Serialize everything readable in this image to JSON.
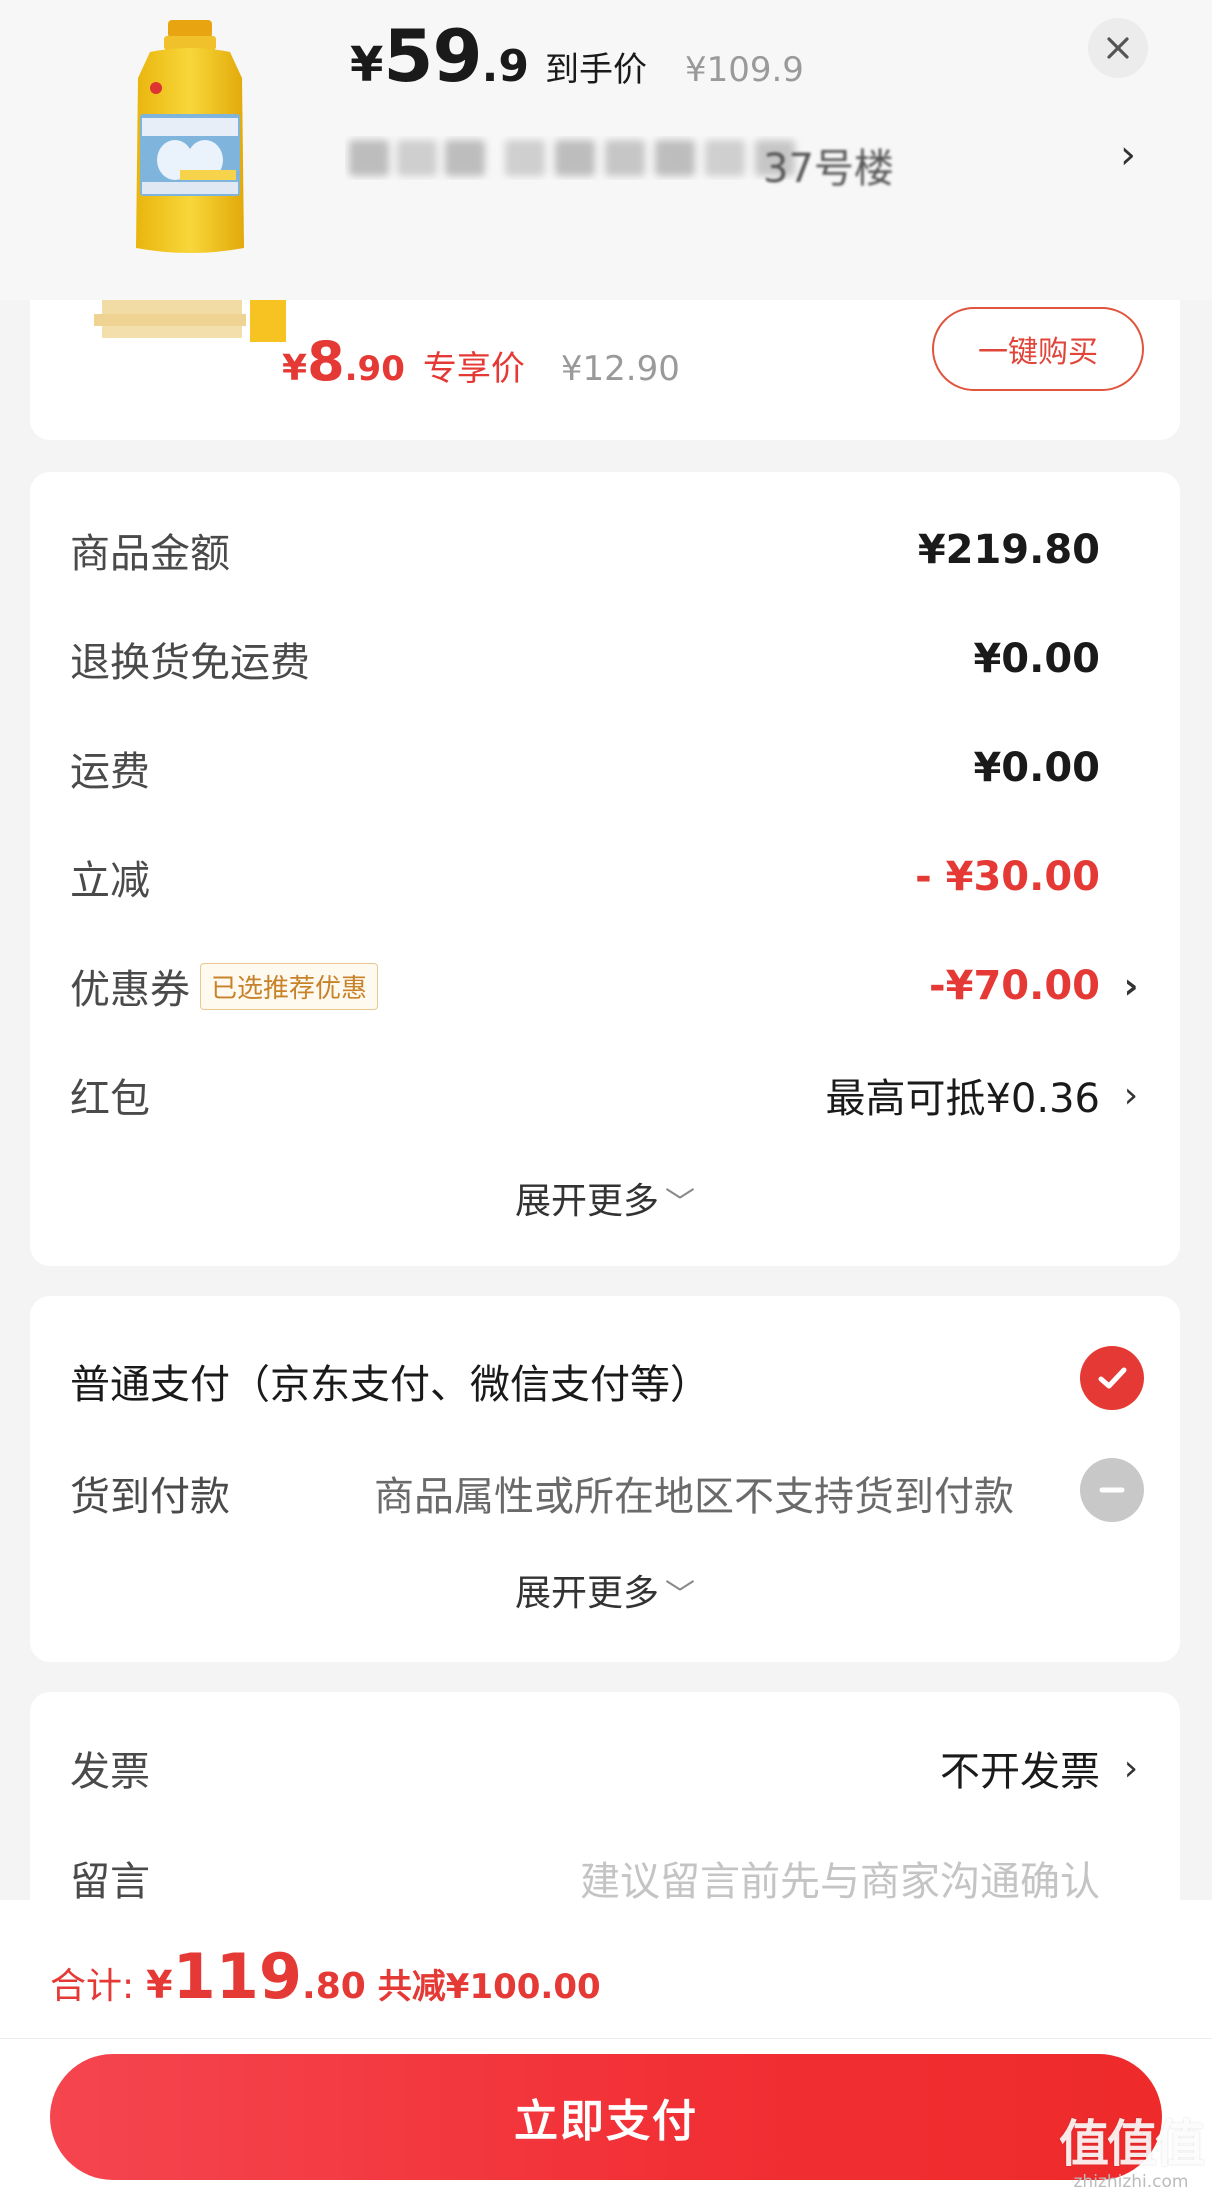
{
  "header": {
    "price_symbol": "¥",
    "price_int": "59",
    "price_dec": ".9",
    "price_label": "到手价",
    "original_price": "¥109.9",
    "address_visible": "37号楼",
    "close_icon": "close-icon",
    "chevron": "›"
  },
  "recommend": {
    "price_symbol": "¥",
    "price_int": "8",
    "price_dec": ".90",
    "price_label": "专享价",
    "original_price": "¥12.90",
    "button_label": "一键购买"
  },
  "amounts": {
    "rows": [
      {
        "label": "商品金额",
        "value": "¥219.80"
      },
      {
        "label": "退换货免运费",
        "value": "¥0.00"
      },
      {
        "label": "运费",
        "value": "¥0.00"
      },
      {
        "label": "立减",
        "value": "- ¥30.00"
      },
      {
        "label": "优惠券",
        "badge": "已选推荐优惠",
        "value": "-¥70.00"
      },
      {
        "label": "红包",
        "value": "最高可抵¥0.36"
      }
    ],
    "expand_label": "展开更多"
  },
  "payment": {
    "main_option": "普通支付（京东支付、微信支付等）",
    "cod_label": "货到付款",
    "cod_note": "商品属性或所在地区不支持货到付款",
    "expand_label": "展开更多"
  },
  "invoice": {
    "label": "发票",
    "value": "不开发票",
    "message_label": "留言",
    "message_placeholder": "建议留言前先与商家沟通确认"
  },
  "footer": {
    "total_label": "合计:",
    "total_symbol": "¥",
    "total_int": "119",
    "total_dec": ".80",
    "total_saved": "共减¥100.00",
    "pay_button": "立即支付"
  },
  "watermark": {
    "logo": "值值值",
    "url": "zhizhizhi.com"
  },
  "colors": {
    "accent": "#e53935",
    "badge_text": "#c8822a",
    "background": "#f4f4f4"
  }
}
